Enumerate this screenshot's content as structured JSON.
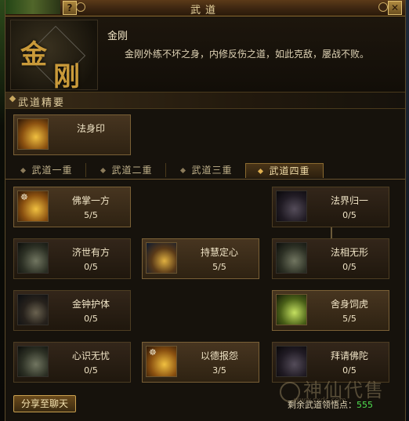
{
  "window": {
    "title": "武道"
  },
  "header": {
    "emblem_glyphs": [
      "金",
      "刚"
    ],
    "skill_name": "金刚",
    "description": "金刚外练不坏之身，内修反伤之道，如此克敌，屡战不败。"
  },
  "section": {
    "title": "武道精要"
  },
  "essence": {
    "name": "法身印",
    "icon": "golden-seal-icon"
  },
  "tabs": [
    {
      "label": "武道一重",
      "active": false
    },
    {
      "label": "武道二重",
      "active": false
    },
    {
      "label": "武道三重",
      "active": false
    },
    {
      "label": "武道四重",
      "active": true
    }
  ],
  "skills": [
    {
      "name": "佛掌一方",
      "level": "5/5",
      "icon": "golden-palm-icon"
    },
    {
      "name": "法界归一",
      "level": "0/5",
      "icon": "purple-wheel-icon"
    },
    {
      "name": "济世有方",
      "level": "0/5",
      "icon": "swastika-icon"
    },
    {
      "name": "持慧定心",
      "level": "5/5",
      "icon": "golden-warrior-icon"
    },
    {
      "name": "法相无形",
      "level": "0/5",
      "icon": "green-form-icon"
    },
    {
      "name": "金钟护体",
      "level": "0/5",
      "icon": "golden-bell-icon"
    },
    {
      "name": "舍身饲虎",
      "level": "5/5",
      "icon": "golden-figure-icon"
    },
    {
      "name": "心识无忧",
      "level": "0/5",
      "icon": "dark-blade-icon"
    },
    {
      "name": "以德报怨",
      "level": "3/5",
      "icon": "golden-slash-icon"
    },
    {
      "name": "拜请佛陀",
      "level": "0/5",
      "icon": "purple-buddha-icon"
    }
  ],
  "footer": {
    "share_label": "分享至聊天",
    "points_label": "剩余武道领悟点：",
    "points_value": "555"
  },
  "watermark": {
    "text": "神仙代售",
    "url": "www.sxds.com"
  },
  "colors": {
    "accent": "#c9a050",
    "points_value": "#4fe04f",
    "background": "#16120c"
  }
}
